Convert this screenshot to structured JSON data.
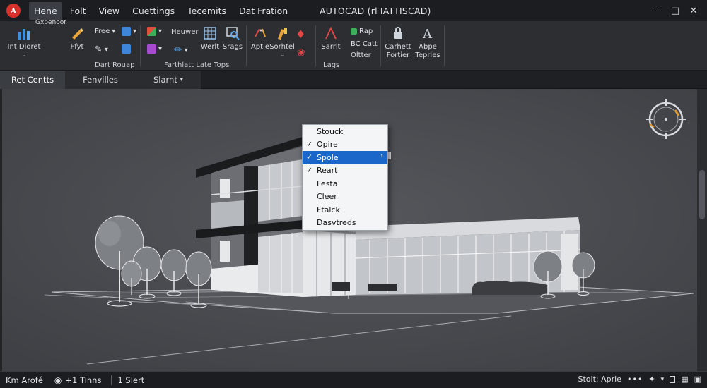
{
  "titlebar": {
    "menu": [
      "Hene",
      "Folt",
      "View",
      "Cuettings",
      "Tecemits",
      "Dat Fration"
    ],
    "active_menu": "Hene",
    "app_title": "AUTOCAD (rl IATTISCAD)"
  },
  "ribbon": {
    "tools": [
      {
        "label": "Int Dioret",
        "icon": "bar-chart-icon"
      },
      {
        "label": "Ffyt",
        "icon": "pencil-icon"
      },
      {
        "label": "Werlt",
        "icon": "grid-icon"
      },
      {
        "label": "Srags",
        "icon": "magnify-icon"
      },
      {
        "label": "Aptle",
        "icon": "pen-icon"
      },
      {
        "label": "Sorhtel",
        "icon": "brush-icon"
      },
      {
        "label": "Sarrlt",
        "icon": "angle-icon"
      },
      {
        "label": "Carhett Fortier",
        "icon": "lock-icon"
      },
      {
        "label": "Abpe Tepries",
        "icon": "text-icon"
      }
    ],
    "small_tools": [
      "Free",
      "Heuwer",
      "Rap",
      "BC Catt",
      "Oltter"
    ],
    "floating_label": "Gxpenoor",
    "group_labels": [
      "Dart Rouap",
      "Farthlatt Late Tops",
      "Lags"
    ]
  },
  "tabs": [
    "Ret Centts",
    "Fenvilles",
    "Slarnt"
  ],
  "context_menu": {
    "items": [
      {
        "label": "Stouck",
        "checked": false,
        "selected": false,
        "submenu": false
      },
      {
        "label": "Opire",
        "checked": true,
        "selected": false,
        "submenu": false
      },
      {
        "label": "Spole",
        "checked": true,
        "selected": true,
        "submenu": true
      },
      {
        "label": "Reart",
        "checked": true,
        "selected": false,
        "submenu": false
      },
      {
        "label": "Lesta",
        "checked": false,
        "selected": false,
        "submenu": false
      },
      {
        "label": "Cleer",
        "checked": false,
        "selected": false,
        "submenu": false
      },
      {
        "label": "Ftalck",
        "checked": false,
        "selected": false,
        "submenu": false
      },
      {
        "label": "Dasvtreds",
        "checked": false,
        "selected": false,
        "submenu": false
      }
    ]
  },
  "status": {
    "left": "Km Arofé",
    "middle": "+1 Tinns",
    "sheet": "1 Slert",
    "right": "Stolt: Aprle"
  },
  "colors": {
    "accent": "#1b66c9",
    "menu_bg": "#f4f5f6",
    "viewport": "#4a4c51",
    "compass_accent": "#e39a2c"
  }
}
